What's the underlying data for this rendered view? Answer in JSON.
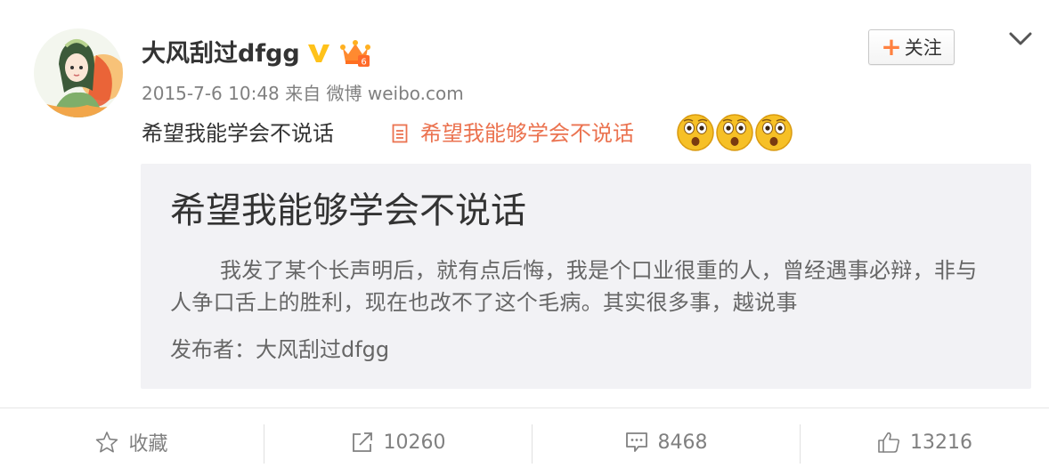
{
  "post": {
    "username": "大风刮过dfgg",
    "timestamp": "2015-7-6 10:48",
    "source_prefix": "来自",
    "source": "微博 weibo.com",
    "text": "希望我能学会不说话",
    "article_link": "希望我能够学会不说话",
    "emoji_icons": [
      "shocked-emoji-icon",
      "shocked-emoji-icon",
      "shocked-emoji-icon"
    ]
  },
  "follow_button": {
    "label": "关注"
  },
  "article_card": {
    "title": "希望我能够学会不说话",
    "excerpt": "我发了某个长声明后，就有点后悔，我是个口业很重的人，曾经遇事必辩，非与人争口舌上的胜利，现在也改不了这个毛病。其实很多事，越说事",
    "author_label": "发布者：",
    "author": "大风刮过dfgg"
  },
  "actions": {
    "favorite_label": "收藏",
    "repost_count": "10260",
    "comment_count": "8468",
    "like_count": "13216"
  },
  "colors": {
    "link": "#eb7350",
    "follow_plus": "#ff8140",
    "verified_badge": "#ffc21a",
    "card_background": "#f2f2f5",
    "meta_text": "#808080"
  }
}
